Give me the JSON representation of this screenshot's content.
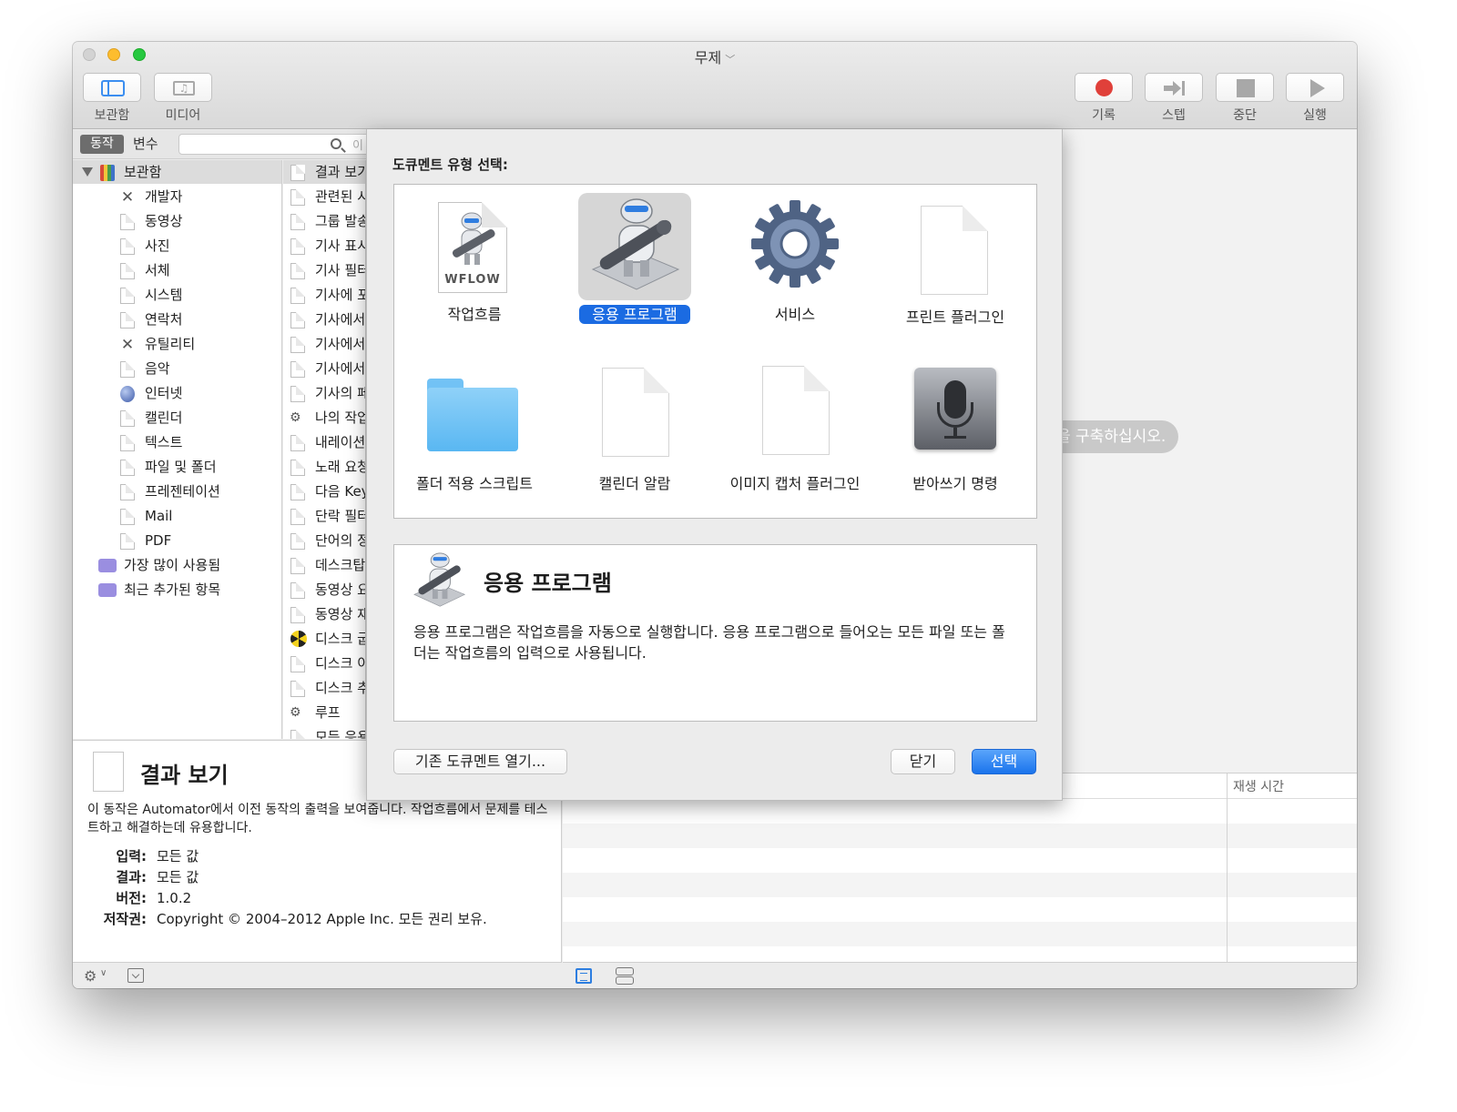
{
  "window": {
    "title": "무제"
  },
  "toolbar": {
    "library_label": "보관함",
    "media_label": "미디어",
    "record_label": "기록",
    "step_label": "스텝",
    "stop_label": "중단",
    "run_label": "실행"
  },
  "sidebar": {
    "tab_actions": "동작",
    "tab_variables": "변수",
    "search_placeholder": "이",
    "library_root": "보관함",
    "categories": [
      {
        "label": "개발자",
        "icon": "tools-icon"
      },
      {
        "label": "동영상",
        "icon": "document-icon"
      },
      {
        "label": "사진",
        "icon": "document-icon"
      },
      {
        "label": "서체",
        "icon": "document-icon"
      },
      {
        "label": "시스템",
        "icon": "document-icon"
      },
      {
        "label": "연락처",
        "icon": "document-icon"
      },
      {
        "label": "유틸리티",
        "icon": "tools-icon"
      },
      {
        "label": "음악",
        "icon": "document-icon"
      },
      {
        "label": "인터넷",
        "icon": "globe-icon"
      },
      {
        "label": "캘린더",
        "icon": "document-icon"
      },
      {
        "label": "텍스트",
        "icon": "document-icon"
      },
      {
        "label": "파일 및 폴더",
        "icon": "document-icon"
      },
      {
        "label": "프레젠테이션",
        "icon": "document-icon"
      },
      {
        "label": "Mail",
        "icon": "document-icon"
      },
      {
        "label": "PDF",
        "icon": "pdf-icon"
      }
    ],
    "smart_groups": [
      "가장 많이 사용됨",
      "최근 추가된 항목"
    ]
  },
  "actions": [
    "결과 보기",
    "관련된 시",
    "그룹 발송",
    "기사 표시",
    "기사 필터",
    "기사에 포",
    "기사에서",
    "기사에서",
    "기사에서",
    "기사의 페",
    "나의 작업",
    "내레이션",
    "노래 요청",
    "다음 Key",
    "단락 필터",
    "단어의 정",
    "데스크탑",
    "동영상 요",
    "동영상 재",
    "디스크 굽",
    "디스크 이",
    "디스크 추",
    "루프",
    "모든 응용"
  ],
  "description": {
    "title": "결과 보기",
    "text": "이 동작은 Automator에서 이전 동작의 출력을 보여줍니다. 작업흐름에서 문제를 테스트하고 해결하는데 유용합니다.",
    "meta": [
      {
        "key": "입력:",
        "value": "모든 값"
      },
      {
        "key": "결과:",
        "value": "모든 값"
      },
      {
        "key": "버전:",
        "value": "1.0.2"
      },
      {
        "key": "저작권:",
        "value": "Copyright © 2004–2012 Apple Inc.  모든 권리 보유."
      }
    ]
  },
  "workflow": {
    "hint": "을 구축하십시오.",
    "log_column_duration": "재생 시간"
  },
  "sheet": {
    "heading": "도큐멘트 유형 선택:",
    "types": [
      {
        "label": "작업흐름",
        "icon": "workflow-file-icon",
        "badge": "WFLOW",
        "selected": false
      },
      {
        "label": "응용 프로그램",
        "icon": "automator-robot-icon",
        "selected": true
      },
      {
        "label": "서비스",
        "icon": "gear-icon",
        "selected": false
      },
      {
        "label": "프린트 플러그인",
        "icon": "blank-document-icon",
        "selected": false
      },
      {
        "label": "폴더 적용 스크립트",
        "icon": "folder-icon",
        "selected": false
      },
      {
        "label": "캘린더 알람",
        "icon": "blank-document-icon",
        "selected": false
      },
      {
        "label": "이미지 캡처 플러그인",
        "icon": "blank-document-icon",
        "selected": false
      },
      {
        "label": "받아쓰기 명령",
        "icon": "microphone-icon",
        "selected": false
      }
    ],
    "detail_title": "응용 프로그램",
    "detail_text": "응용 프로그램은 작업흐름을 자동으로 실행합니다. 응용 프로그램으로 들어오는 모든 파일 또는 폴더는 작업흐름의 입력으로 사용됩니다.",
    "open_existing_label": "기존 도큐멘트 열기...",
    "close_label": "닫기",
    "choose_label": "선택"
  },
  "colors": {
    "accent": "#1b6be2",
    "record": "#e0403a"
  }
}
